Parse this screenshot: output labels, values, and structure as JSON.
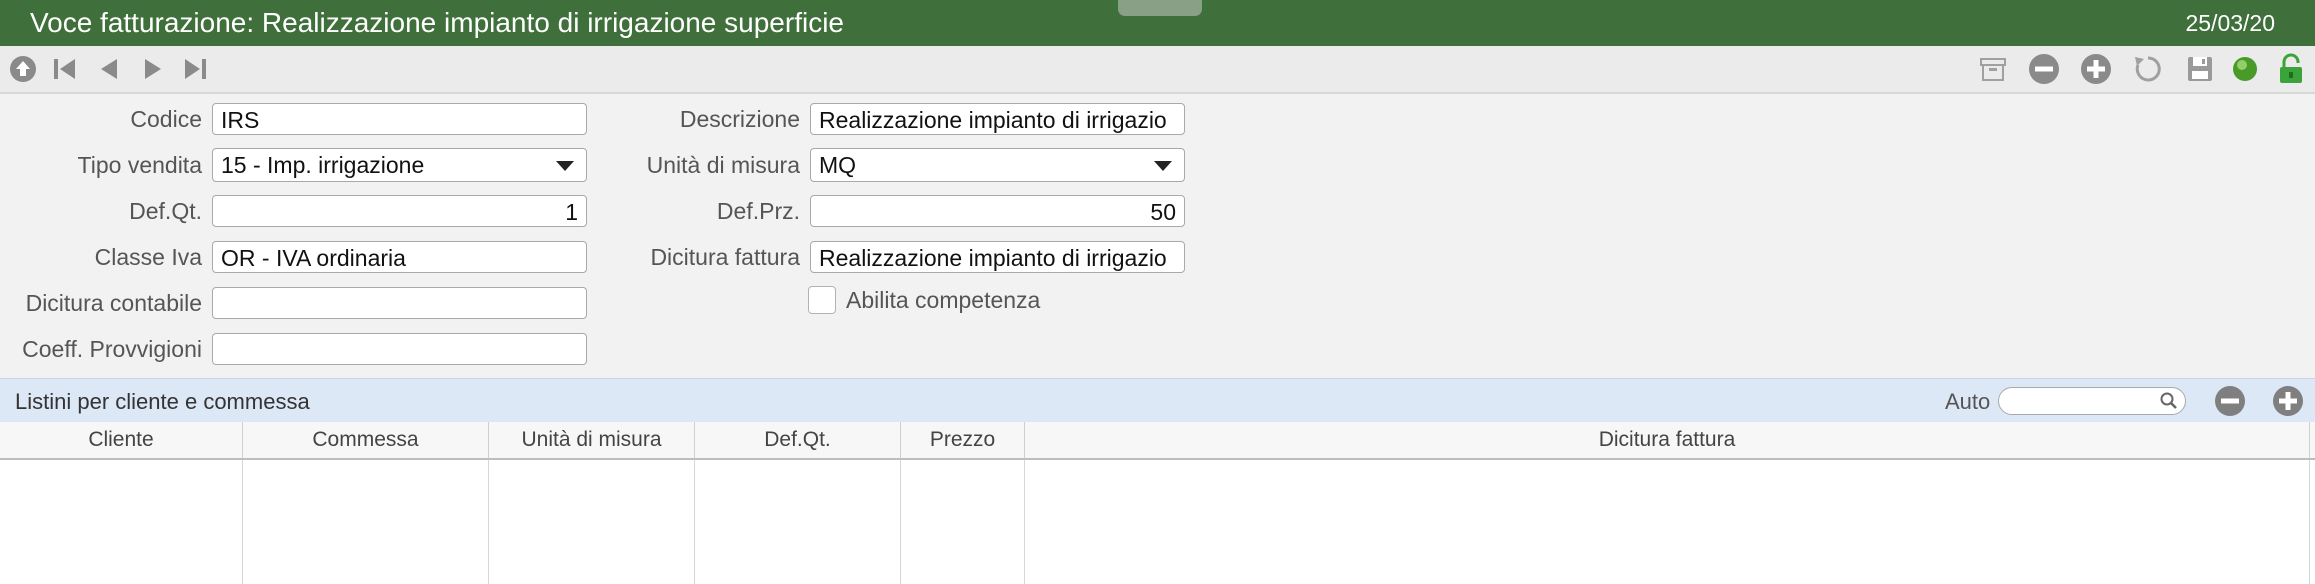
{
  "window": {
    "title": "Voce fatturazione: Realizzazione impianto di irrigazione superficie",
    "date": "25/03/20"
  },
  "toolbar": {
    "left_icons": [
      "home-up-icon",
      "first-record-icon",
      "previous-record-icon",
      "next-record-icon",
      "last-record-icon"
    ],
    "right_icons": [
      "archive-icon",
      "remove-icon",
      "add-icon",
      "refresh-icon",
      "save-icon",
      "status-green-icon",
      "unlock-icon"
    ]
  },
  "form": {
    "codice": {
      "label": "Codice",
      "value": "IRS"
    },
    "descrizione": {
      "label": "Descrizione",
      "value": "Realizzazione impianto di irrigazio"
    },
    "tipo_vendita": {
      "label": "Tipo vendita",
      "value": "15 - Imp. irrigazione"
    },
    "unita_misura": {
      "label": "Unità di misura",
      "value": "MQ"
    },
    "def_qt": {
      "label": "Def.Qt.",
      "value": "1"
    },
    "def_prz": {
      "label": "Def.Prz.",
      "value": "50"
    },
    "classe_iva": {
      "label": "Classe Iva",
      "value": "OR - IVA ordinaria"
    },
    "dicitura_fattura": {
      "label": "Dicitura fattura",
      "value": "Realizzazione impianto di irrigazio"
    },
    "dicitura_contabile": {
      "label": "Dicitura contabile",
      "value": ""
    },
    "abilita_competenza": {
      "label": "Abilita competenza",
      "checked": false
    },
    "coeff_provvigioni": {
      "label": "Coeff. Provvigioni",
      "value": ""
    }
  },
  "listini": {
    "title": "Listini per cliente e commessa",
    "auto_label": "Auto",
    "search_value": "",
    "columns": [
      "Cliente",
      "Commessa",
      "Unità di misura",
      "Def.Qt.",
      "Prezzo",
      "Dicitura fattura"
    ],
    "rows": []
  },
  "colors": {
    "titlebar": "#3f6f3a",
    "section_bar": "#dde8f7",
    "icon_gray": "#8a8a8a",
    "status_green": "#4a9a2a",
    "lock_green": "#3aa33a"
  }
}
